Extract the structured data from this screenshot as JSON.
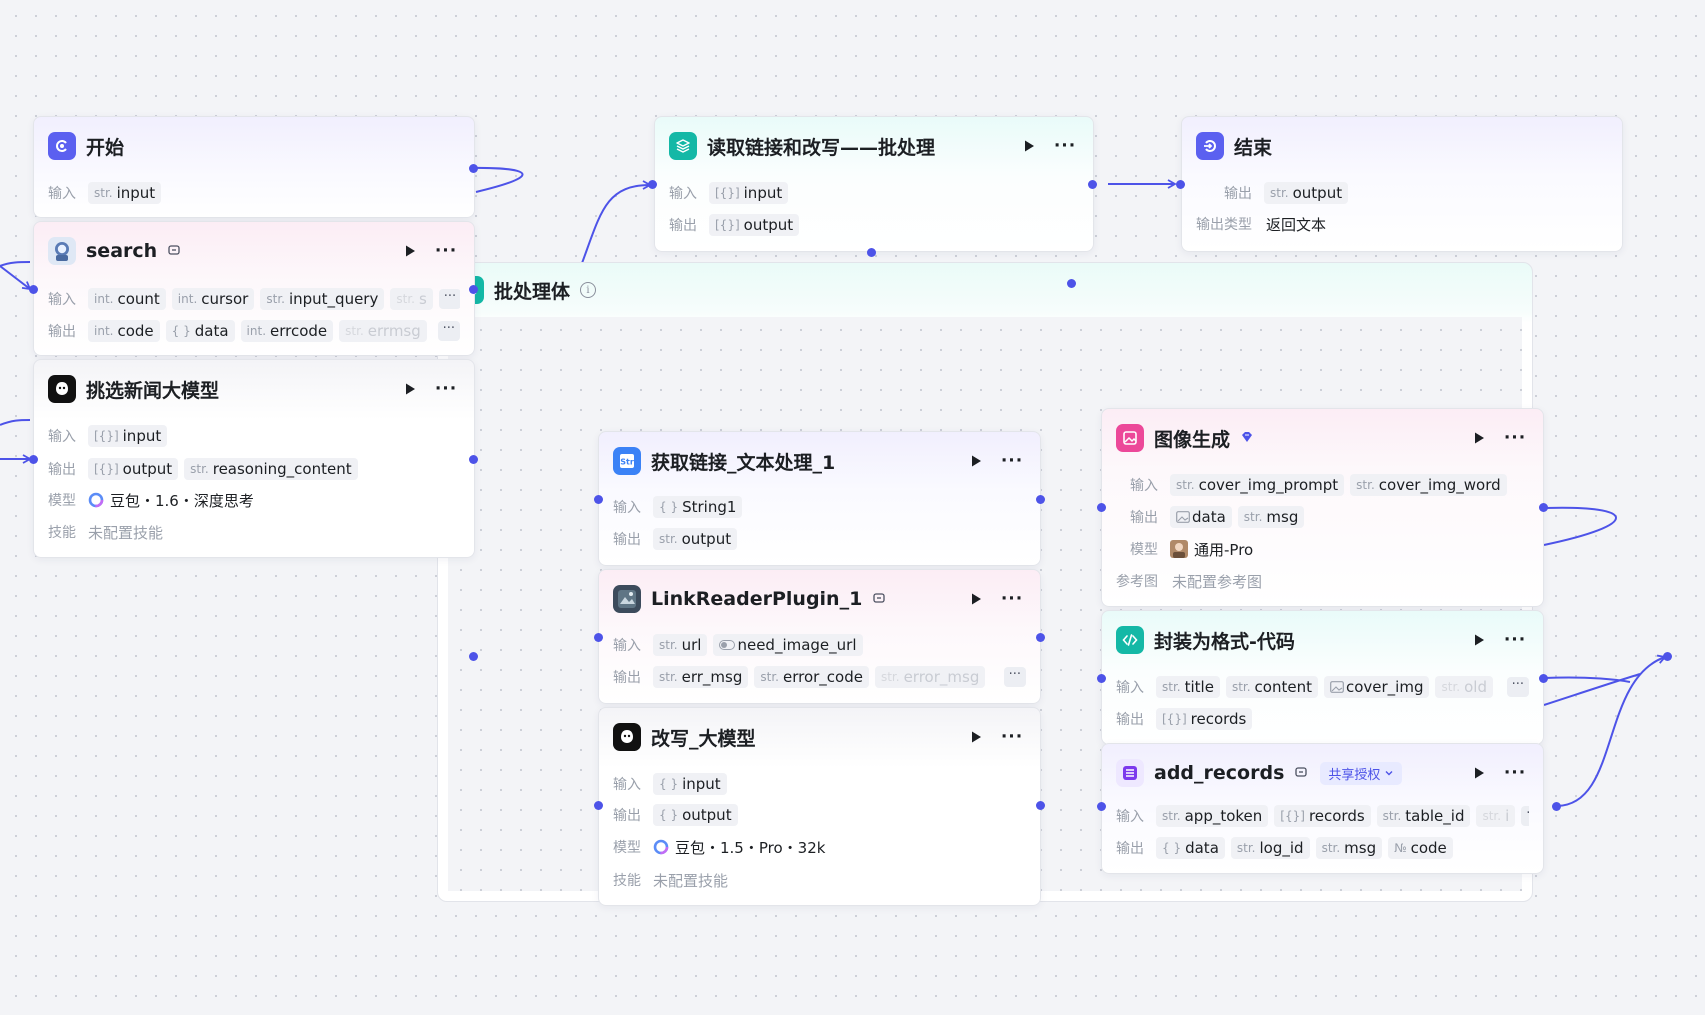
{
  "labels": {
    "input": "输入",
    "output": "输出",
    "model": "模型",
    "skill": "技能",
    "output_type": "输出类型",
    "ref_image": "参考图"
  },
  "colors": {
    "accent": "#4d53e8",
    "start": "#5b60f0",
    "batch": "#14b8a6",
    "image_gen": "#ec4899",
    "code": "#14b8a6",
    "records": "#7c3aed"
  },
  "nodes": {
    "start": {
      "title": "开始",
      "icon": "play-circle-icon",
      "inputs": [
        {
          "type": "str.",
          "name": "input"
        }
      ]
    },
    "search": {
      "title": "search",
      "icon": "astronaut-avatar-icon",
      "inputs": [
        {
          "type": "int.",
          "name": "count"
        },
        {
          "type": "int.",
          "name": "cursor"
        },
        {
          "type": "str.",
          "name": "input_query"
        },
        {
          "type": "str.",
          "name": "s"
        }
      ],
      "outputs": [
        {
          "type": "int.",
          "name": "code"
        },
        {
          "type": "{ }",
          "name": "data"
        },
        {
          "type": "int.",
          "name": "errcode"
        },
        {
          "type": "str.",
          "name": "errmsg"
        }
      ],
      "more": "···"
    },
    "pick_news": {
      "title": "挑选新闻大模型",
      "icon": "llm-icon",
      "inputs": [
        {
          "type": "[{}]",
          "name": "input"
        }
      ],
      "outputs": [
        {
          "type": "[{}]",
          "name": "output"
        },
        {
          "type": "str.",
          "name": "reasoning_content"
        }
      ],
      "model": "豆包・1.6・深度思考",
      "skill": "未配置技能"
    },
    "batch": {
      "title": "读取链接和改写——批处理",
      "icon": "layers-icon",
      "inputs": [
        {
          "type": "[{}]",
          "name": "input"
        }
      ],
      "outputs": [
        {
          "type": "[{}]",
          "name": "output"
        }
      ]
    },
    "end": {
      "title": "结束",
      "icon": "exit-icon",
      "outputs": [
        {
          "type": "str.",
          "name": "output"
        }
      ],
      "output_type": "返回文本"
    },
    "batch_body": {
      "title": "批处理体"
    },
    "get_link": {
      "title": "获取链接_文本处理_1",
      "icon": "text-process-icon",
      "inputs": [
        {
          "type": "{ }",
          "name": "String1"
        }
      ],
      "outputs": [
        {
          "type": "str.",
          "name": "output"
        }
      ]
    },
    "link_reader": {
      "title": "LinkReaderPlugin_1",
      "icon": "plugin-avatar-icon",
      "inputs": [
        {
          "type": "str.",
          "name": "url"
        },
        {
          "type": "toggle",
          "name": "need_image_url"
        }
      ],
      "outputs": [
        {
          "type": "str.",
          "name": "err_msg"
        },
        {
          "type": "str.",
          "name": "error_code"
        },
        {
          "type": "str.",
          "name": "error_msg"
        }
      ],
      "more": "···"
    },
    "rewrite": {
      "title": "改写_大模型",
      "icon": "llm-icon",
      "inputs": [
        {
          "type": "{ }",
          "name": "input"
        }
      ],
      "outputs": [
        {
          "type": "{ }",
          "name": "output"
        }
      ],
      "model": "豆包・1.5・Pro・32k",
      "skill": "未配置技能"
    },
    "image_gen": {
      "title": "图像生成",
      "icon": "image-icon",
      "inputs": [
        {
          "type": "str.",
          "name": "cover_img_prompt"
        },
        {
          "type": "str.",
          "name": "cover_img_word"
        }
      ],
      "outputs": [
        {
          "type": "img",
          "name": "data"
        },
        {
          "type": "str.",
          "name": "msg"
        }
      ],
      "model": "通用-Pro",
      "ref_image": "未配置参考图"
    },
    "code": {
      "title": "封装为格式-代码",
      "icon": "code-icon",
      "inputs": [
        {
          "type": "str.",
          "name": "title"
        },
        {
          "type": "str.",
          "name": "content"
        },
        {
          "type": "img",
          "name": "cover_img"
        },
        {
          "type": "str.",
          "name": "old"
        }
      ],
      "outputs": [
        {
          "type": "[{}]",
          "name": "records"
        }
      ],
      "more": "···"
    },
    "add_records": {
      "title": "add_records",
      "icon": "table-icon",
      "auth": "共享授权",
      "inputs": [
        {
          "type": "str.",
          "name": "app_token"
        },
        {
          "type": "[{}]",
          "name": "records"
        },
        {
          "type": "str.",
          "name": "table_id"
        },
        {
          "type": "str.",
          "name": "i"
        }
      ],
      "outputs": [
        {
          "type": "{ }",
          "name": "data"
        },
        {
          "type": "str.",
          "name": "log_id"
        },
        {
          "type": "str.",
          "name": "msg"
        },
        {
          "type": "№",
          "name": "code"
        }
      ],
      "more": "···"
    }
  }
}
